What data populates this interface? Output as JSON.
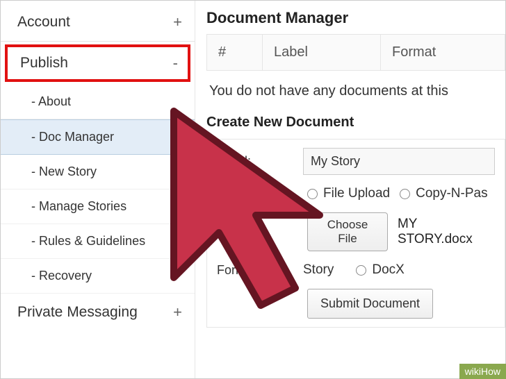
{
  "sidebar": {
    "account": {
      "label": "Account",
      "toggle": "+"
    },
    "publish": {
      "label": "Publish",
      "toggle": "-",
      "items": [
        {
          "label": "- About"
        },
        {
          "label": "- Doc Manager"
        },
        {
          "label": "- New Story"
        },
        {
          "label": "- Manage Stories"
        },
        {
          "label": "- Rules & Guidelines"
        },
        {
          "label": "- Recovery"
        }
      ]
    },
    "pm": {
      "label": "Private Messaging",
      "toggle": "+"
    }
  },
  "main": {
    "title": "Document Manager",
    "table": {
      "cols": [
        "#",
        "Label",
        "Format"
      ]
    },
    "empty": "You do not have any documents at this",
    "create_heading": "Create New Document",
    "label_field": {
      "label": "Label:",
      "value": "My Story"
    },
    "method": {
      "opt_upload": "File Upload",
      "opt_paste": "Copy-N-Pas"
    },
    "file": {
      "button": "Choose File",
      "name": "MY STORY.docx"
    },
    "format": {
      "label": "Format:",
      "opt_story": "Story",
      "opt_docx": "DocX"
    },
    "submit": "Submit Document"
  },
  "watermark": "wikiHow"
}
